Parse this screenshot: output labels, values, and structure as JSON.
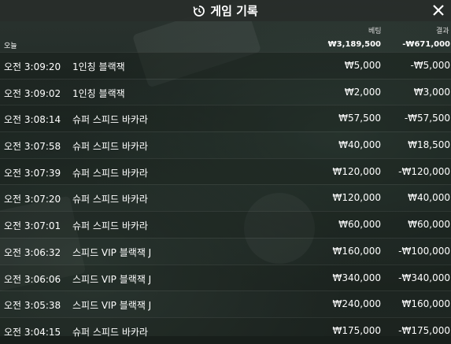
{
  "header": {
    "title": "게임 기록",
    "icon": "history-icon",
    "close_icon": "close-icon"
  },
  "columns": {
    "bet": "베팅",
    "result": "결과"
  },
  "summary": {
    "label": "오늘",
    "bet": "₩3,189,500",
    "result": "-₩671,000"
  },
  "rows": [
    {
      "time": "오전 3:09:20",
      "game": "1인칭 블랙잭",
      "bet": "₩5,000",
      "result": "-₩5,000"
    },
    {
      "time": "오전 3:09:02",
      "game": "1인칭 블랙잭",
      "bet": "₩2,000",
      "result": "₩3,000"
    },
    {
      "time": "오전 3:08:14",
      "game": "슈퍼 스피드 바카라",
      "bet": "₩57,500",
      "result": "-₩57,500"
    },
    {
      "time": "오전 3:07:58",
      "game": "슈퍼 스피드 바카라",
      "bet": "₩40,000",
      "result": "₩18,500"
    },
    {
      "time": "오전 3:07:39",
      "game": "슈퍼 스피드 바카라",
      "bet": "₩120,000",
      "result": "-₩120,000"
    },
    {
      "time": "오전 3:07:20",
      "game": "슈퍼 스피드 바카라",
      "bet": "₩120,000",
      "result": "₩40,000"
    },
    {
      "time": "오전 3:07:01",
      "game": "슈퍼 스피드 바카라",
      "bet": "₩60,000",
      "result": "₩60,000"
    },
    {
      "time": "오전 3:06:32",
      "game": "스피드 VIP 블랙잭 J",
      "bet": "₩160,000",
      "result": "-₩100,000"
    },
    {
      "time": "오전 3:06:06",
      "game": "스피드 VIP 블랙잭 J",
      "bet": "₩340,000",
      "result": "-₩340,000"
    },
    {
      "time": "오전 3:05:38",
      "game": "스피드 VIP 블랙잭 J",
      "bet": "₩240,000",
      "result": "₩160,000"
    },
    {
      "time": "오전 3:04:15",
      "game": "슈퍼 스피드 바카라",
      "bet": "₩175,000",
      "result": "-₩175,000"
    }
  ]
}
